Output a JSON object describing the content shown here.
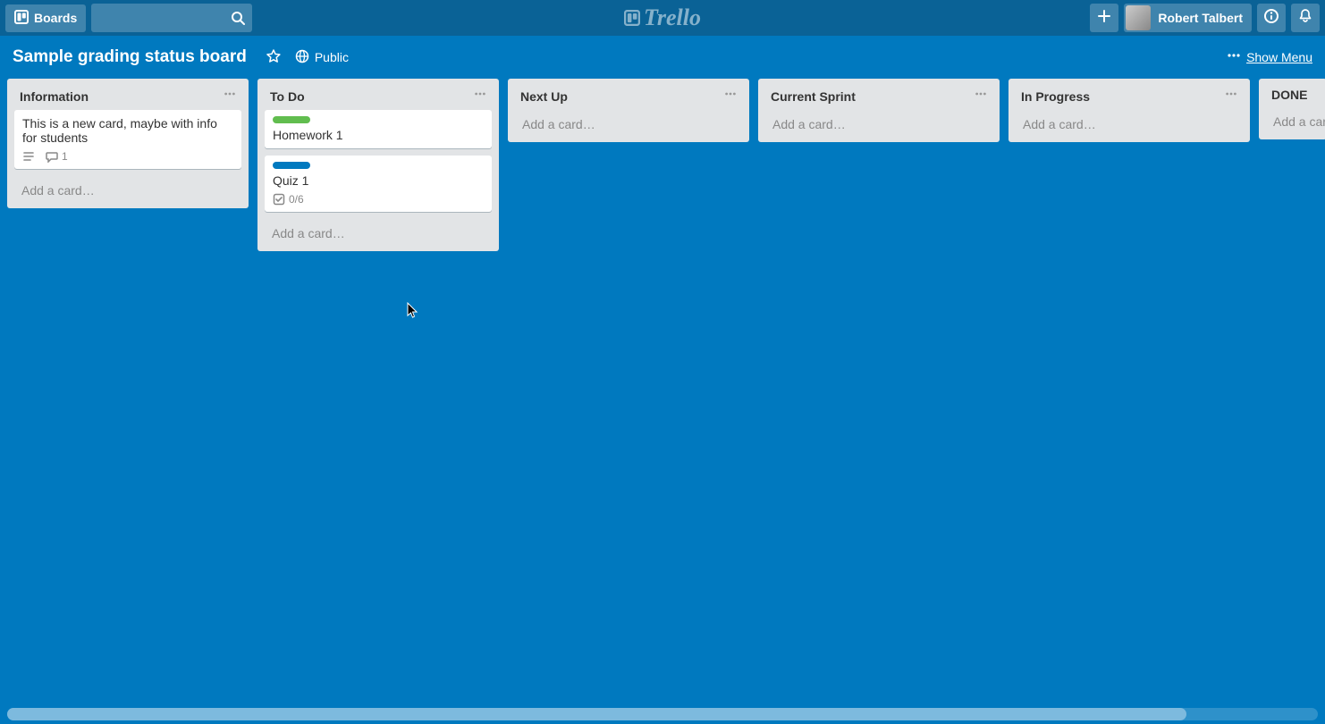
{
  "header": {
    "boards_label": "Boards",
    "logo_text": "Trello",
    "user_name": "Robert Talbert"
  },
  "board": {
    "title": "Sample grading status board",
    "visibility": "Public",
    "show_menu_label": "Show Menu"
  },
  "lists": [
    {
      "title": "Information",
      "add_label": "Add a card…",
      "cards": [
        {
          "text": "This is a new card, maybe with info for students",
          "has_desc": true,
          "comment_count": "1"
        }
      ]
    },
    {
      "title": "To Do",
      "add_label": "Add a card…",
      "cards": [
        {
          "text": "Homework 1",
          "label_color": "green"
        },
        {
          "text": "Quiz 1",
          "label_color": "blue",
          "checklist": "0/6"
        }
      ]
    },
    {
      "title": "Next Up",
      "add_label": "Add a card…"
    },
    {
      "title": "Current Sprint",
      "add_label": "Add a card…"
    },
    {
      "title": "In Progress",
      "add_label": "Add a card…"
    },
    {
      "title": "DONE",
      "add_label": "Add a card…"
    }
  ]
}
